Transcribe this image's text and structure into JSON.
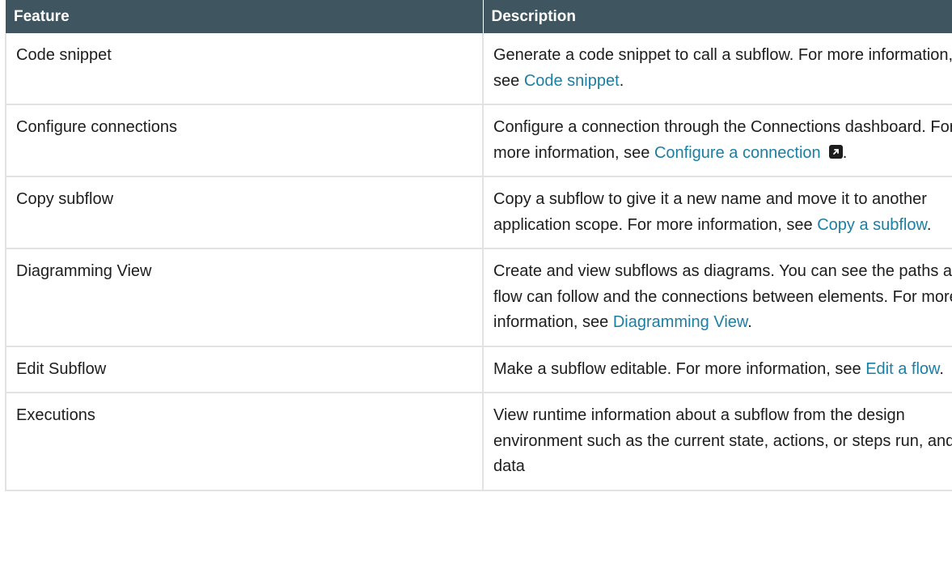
{
  "table": {
    "headers": [
      "Feature",
      "Description"
    ],
    "rows": [
      {
        "feature": "Code snippet",
        "desc_before": "Generate a code snippet to call a subflow. For more information, see ",
        "link": "Code snippet",
        "desc_after": ".",
        "external": false
      },
      {
        "feature": "Configure connections",
        "desc_before": "Configure a connection through the Connections dashboard. For more information, see ",
        "link": "Configure a connection",
        "desc_after": ".",
        "external": true
      },
      {
        "feature": "Copy subflow",
        "desc_before": "Copy a subflow to give it a new name and move it to another application scope. For more information, see ",
        "link": "Copy a subflow",
        "desc_after": ".",
        "external": false
      },
      {
        "feature": "Diagramming View",
        "desc_before": "Create and view subflows as diagrams. You can see the paths a flow can follow and the connections between elements. For more information, see ",
        "link": "Diagramming View",
        "desc_after": ".",
        "external": false
      },
      {
        "feature": "Edit Subflow",
        "desc_before": "Make a subflow editable. For more information, see ",
        "link": "Edit a flow",
        "desc_after": ".",
        "external": false
      },
      {
        "feature": "Executions",
        "desc_before": "View runtime information about a subflow from the design environment such as the current state, actions, or steps run, and data",
        "link": "",
        "desc_after": "",
        "external": false
      }
    ]
  },
  "colors": {
    "header_bg": "#3f5560",
    "link": "#1a7fa3",
    "border": "#e2e2e2"
  }
}
